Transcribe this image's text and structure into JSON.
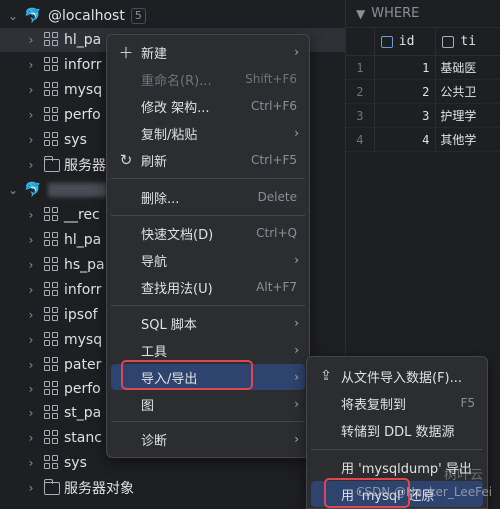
{
  "tree": {
    "connection_1": {
      "label": "@localhost",
      "badge": "5"
    },
    "items_1": [
      {
        "label": "hl_pa",
        "type": "schema"
      },
      {
        "label": "inforr",
        "type": "schema"
      },
      {
        "label": "mysq",
        "type": "schema"
      },
      {
        "label": "perfo",
        "type": "schema"
      },
      {
        "label": "sys",
        "type": "schema"
      },
      {
        "label": "服务器",
        "type": "folder"
      }
    ],
    "items_2": [
      {
        "label": "__rec",
        "type": "schema"
      },
      {
        "label": "hl_pa",
        "type": "schema"
      },
      {
        "label": "hs_pa",
        "type": "schema"
      },
      {
        "label": "inforr",
        "type": "schema"
      },
      {
        "label": "ipsof",
        "type": "schema"
      },
      {
        "label": "mysq",
        "type": "schema"
      },
      {
        "label": "pater",
        "type": "schema"
      },
      {
        "label": "perfo",
        "type": "schema"
      },
      {
        "label": "st_pa",
        "type": "schema"
      },
      {
        "label": "stanc",
        "type": "schema"
      },
      {
        "label": "sys",
        "type": "schema"
      },
      {
        "label": "服务器对象",
        "type": "folder"
      }
    ]
  },
  "grid": {
    "filter_label": "WHERE",
    "columns": [
      "id",
      "ti"
    ],
    "rows": [
      {
        "n": "1",
        "id": "1",
        "name": "基础医"
      },
      {
        "n": "2",
        "id": "2",
        "name": "公共卫"
      },
      {
        "n": "3",
        "id": "3",
        "name": "护理学"
      },
      {
        "n": "4",
        "id": "4",
        "name": "其他学"
      }
    ]
  },
  "menu": {
    "new": "新建",
    "rename": "重命名(R)...",
    "rename_sc": "Shift+F6",
    "modify_schema": "修改 架构...",
    "modify_schema_sc": "Ctrl+F6",
    "copy_paste": "复制/粘贴",
    "refresh": "刷新",
    "refresh_sc": "Ctrl+F5",
    "delete": "删除...",
    "delete_sc": "Delete",
    "quick_doc": "快速文档(D)",
    "quick_doc_sc": "Ctrl+Q",
    "navigate": "导航",
    "find_usages": "查找用法(U)",
    "find_usages_sc": "Alt+F7",
    "sql_script": "SQL 脚本",
    "tools": "工具",
    "import_export": "导入/导出",
    "diagram": "图",
    "diagnostics": "诊断"
  },
  "submenu": {
    "import_from_file": "从文件导入数据(F)...",
    "copy_tables": "将表复制到",
    "copy_tables_sc": "F5",
    "dump_ddl": "转储到 DDL 数据源",
    "mysqldump_export": "用 'mysqldump' 导出",
    "mysql_restore": "用 'mysql' 还原"
  },
  "watermark": {
    "text": "CSDN @Hacker_LeeFei",
    "site": "树叶云"
  },
  "colors": {
    "background": "#1e1f22",
    "menu_bg": "#2b2d30",
    "highlight": "#2e436e",
    "annotation": "#e0464d",
    "dolphin": "#3e8bd6"
  }
}
